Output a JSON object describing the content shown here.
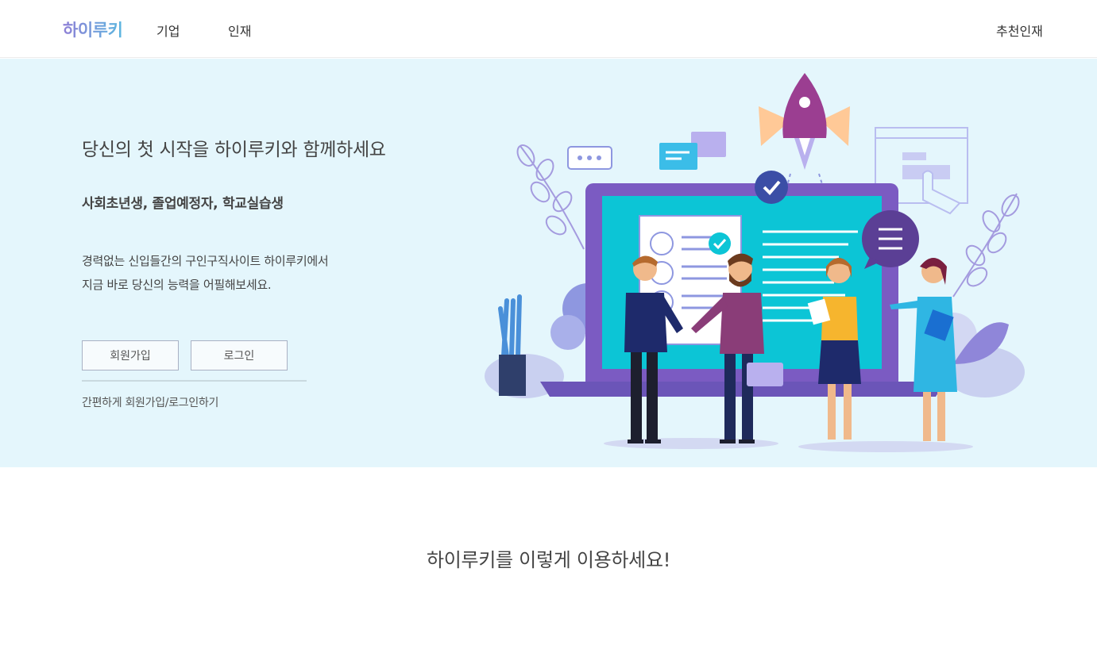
{
  "nav": {
    "logo": "하이루키",
    "links": [
      "기업",
      "인재"
    ],
    "right_link": "추천인재"
  },
  "hero": {
    "headline": "당신의 첫 시작을 하이루키와 함께하세요",
    "subhead": "사회초년생, 졸업예정자, 학교실습생",
    "description": [
      "경력없는 신입들간의 구인구직사이트 하이루키에서",
      "지금 바로 당신의 능력을 어필해보세요."
    ],
    "signup_label": "회원가입",
    "login_label": "로그인",
    "easy_link": "간편하게 회원가입/로그인하기"
  },
  "section": {
    "title": "하이루키를 이렇게 이용하세요!"
  },
  "colors": {
    "hero_bg": "#e4f6fc",
    "laptop": "#7b5bc2",
    "screen": "#0cc5d6",
    "accent_purple": "#8f7fd6"
  }
}
